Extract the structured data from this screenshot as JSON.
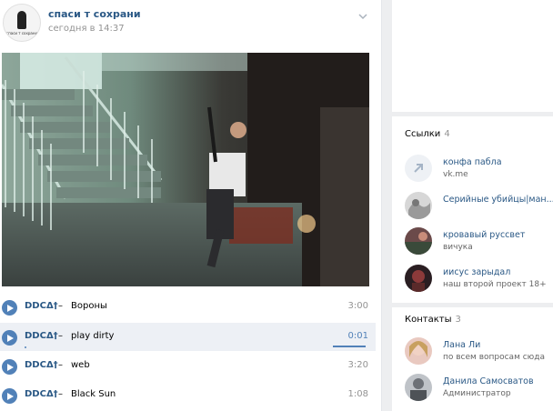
{
  "post": {
    "group_name": "спаси т сохрани",
    "time": "сегодня в 14:37",
    "avatar_caption": "спаси т сохрани"
  },
  "tracks": [
    {
      "artist": "DDCΔ†",
      "sep": "–",
      "title": "Вороны",
      "duration": "3:00",
      "active": false
    },
    {
      "artist": "DDCΔ†",
      "sep": "–",
      "title": "play dirty",
      "duration": "0:01",
      "active": true
    },
    {
      "artist": "DDCΔ†",
      "sep": "–",
      "title": "web",
      "duration": "3:20",
      "active": false
    },
    {
      "artist": "DDCΔ†",
      "sep": "–",
      "title": "Black Sun",
      "duration": "1:08",
      "active": false
    }
  ],
  "links": {
    "title": "Ссылки",
    "count": "4",
    "items": [
      {
        "name": "конфа пабла",
        "sub": "vk.me"
      },
      {
        "name": "Серийные убийцы|ман...",
        "sub": ""
      },
      {
        "name": "кровавый руссвет",
        "sub": "вичука"
      },
      {
        "name": "иисус зарыдал",
        "sub": "наш второй проект 18+"
      }
    ]
  },
  "contacts": {
    "title": "Контакты",
    "count": "3",
    "items": [
      {
        "name": "Лана Ли",
        "sub": "по всем вопросам сюда"
      },
      {
        "name": "Данила Самосватов",
        "sub": "Администратор"
      }
    ]
  },
  "colors": {
    "link": "#2a5885",
    "accent": "#5181b8",
    "muted": "#939393"
  }
}
